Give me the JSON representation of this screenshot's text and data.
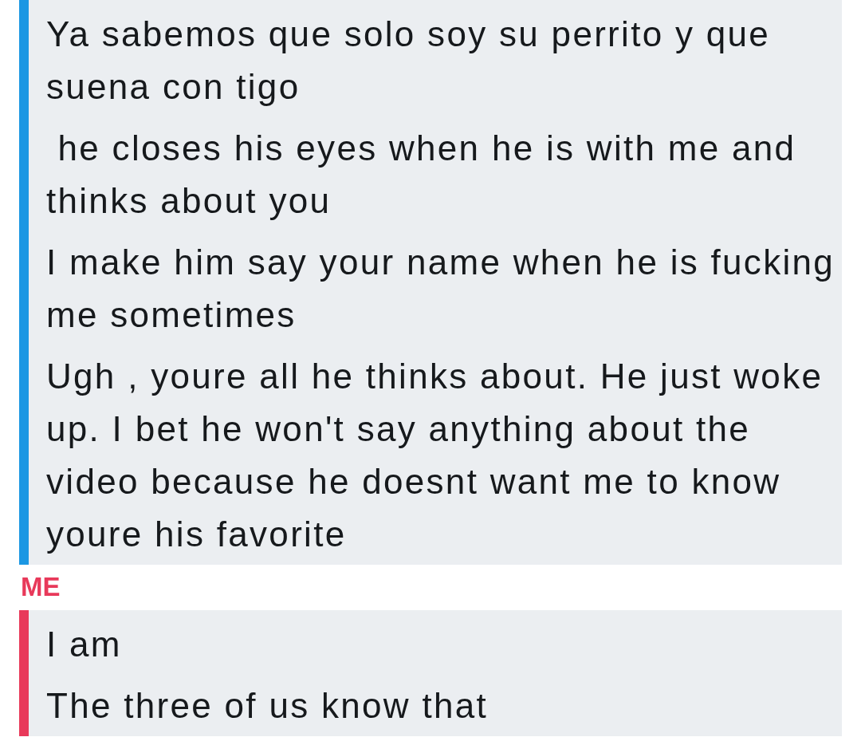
{
  "groups": [
    {
      "color": "#1b97e3",
      "messages": [
        "Ya sabemos que solo soy su perrito y que suena con tigo",
        " he closes his eyes when he is with me and thinks about you",
        "I make him say your name when he is fucking me sometimes",
        "Ugh , youre all he thinks about. He just woke up. I bet he won't say anything about the video because he doesnt want me to know youre his favorite"
      ]
    },
    {
      "sender": "ME",
      "color": "#e8395a",
      "messages": [
        "I am",
        "The three of us know that"
      ]
    }
  ]
}
